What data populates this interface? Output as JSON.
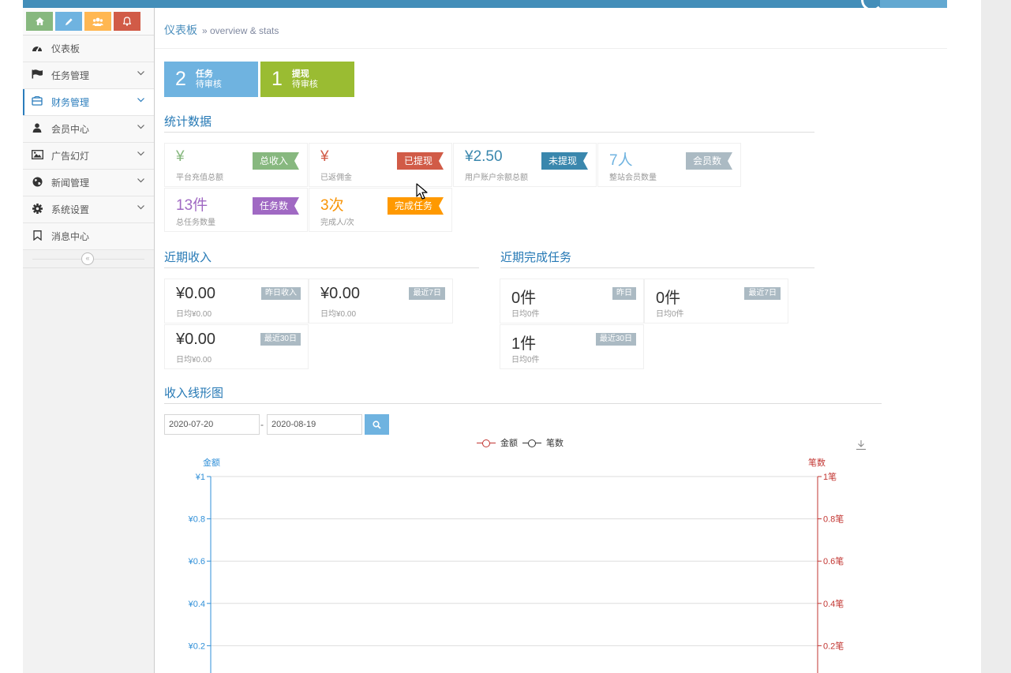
{
  "breadcrumb": {
    "title": "仪表板",
    "sub": "» overview & stats"
  },
  "sidebar": {
    "shortcut_icons": [
      "home-icon",
      "pencil-icon",
      "users-icon",
      "bell-icon"
    ],
    "items": [
      {
        "label": "仪表板",
        "icon": "dashboard-icon"
      },
      {
        "label": "任务管理",
        "icon": "flag-icon"
      },
      {
        "label": "财务管理",
        "icon": "wallet-icon"
      },
      {
        "label": "会员中心",
        "icon": "user-icon"
      },
      {
        "label": "广告幻灯",
        "icon": "picture-icon"
      },
      {
        "label": "新闻管理",
        "icon": "globe-icon"
      },
      {
        "label": "系统设置",
        "icon": "gear-icon"
      },
      {
        "label": "消息中心",
        "icon": "bookmark-icon"
      }
    ],
    "collapse_glyph": "«"
  },
  "infoboxes": [
    {
      "num": "2",
      "title": "任务",
      "sub": "待审核",
      "color": "#6fb3e0"
    },
    {
      "num": "1",
      "title": "提现",
      "sub": "待审核",
      "color": "#9abc32"
    }
  ],
  "stats": {
    "title": "统计数据",
    "items": [
      {
        "value": "¥",
        "desc": "平台充值总额",
        "tag": "总收入",
        "value_color": "#87b87f"
      },
      {
        "value": "¥",
        "desc": "已返佣金",
        "tag": "已提现",
        "value_color": "#d15b47"
      },
      {
        "value": "¥2.50",
        "desc": "用户账户余额总额",
        "tag": "未提现",
        "value_color": "#3a87ad"
      },
      {
        "value": "7人",
        "desc": "整站会员数量",
        "tag": "会员数",
        "value_color": "#6fb3e0"
      },
      {
        "value": "13件",
        "desc": "总任务数量",
        "tag": "任务数",
        "value_color": "#a069c3"
      },
      {
        "value": "3次",
        "desc": "完成人/次",
        "tag": "完成任务",
        "value_color": "#f89406"
      }
    ]
  },
  "income": {
    "title": "近期收入",
    "items": [
      {
        "value": "¥0.00",
        "desc": "日均¥0.00",
        "tag": "昨日收入"
      },
      {
        "value": "¥0.00",
        "desc": "日均¥0.00",
        "tag": "最近7日"
      },
      {
        "value": "¥0.00",
        "desc": "日均¥0.00",
        "tag": "最近30日"
      }
    ]
  },
  "tasks": {
    "title": "近期完成任务",
    "items": [
      {
        "value": "0件",
        "desc": "日均0件",
        "tag": "昨日"
      },
      {
        "value": "0件",
        "desc": "日均0件",
        "tag": "最近7日"
      },
      {
        "value": "1件",
        "desc": "日均0件",
        "tag": "最近30日"
      }
    ]
  },
  "chart_section": {
    "title": "收入线形图",
    "date_from": "2020-07-20",
    "date_sep": "-",
    "date_to": "2020-08-19"
  },
  "chart_data": {
    "type": "line",
    "title": "",
    "legend": [
      "金额",
      "笔数"
    ],
    "legend_placement": "top-center",
    "series": [
      {
        "name": "金额",
        "axis": "left",
        "color": "#c23531",
        "values": []
      },
      {
        "name": "笔数",
        "axis": "right",
        "color": "#333333",
        "values": []
      }
    ],
    "y_left": {
      "name": "金额",
      "color": "#2f8fd8",
      "ticks": [
        "¥1",
        "¥0.8",
        "¥0.6",
        "¥0.4",
        "¥0.2"
      ],
      "tick_values": [
        1,
        0.8,
        0.6,
        0.4,
        0.2
      ],
      "ylim": [
        0,
        1
      ]
    },
    "y_right": {
      "name": "笔数",
      "color": "#c23531",
      "ticks": [
        "1笔",
        "0.8笔",
        "0.6笔",
        "0.4笔",
        "0.2笔"
      ],
      "tick_values": [
        1,
        0.8,
        0.6,
        0.4,
        0.2
      ],
      "ylim": [
        0,
        1
      ]
    },
    "grid": true
  }
}
